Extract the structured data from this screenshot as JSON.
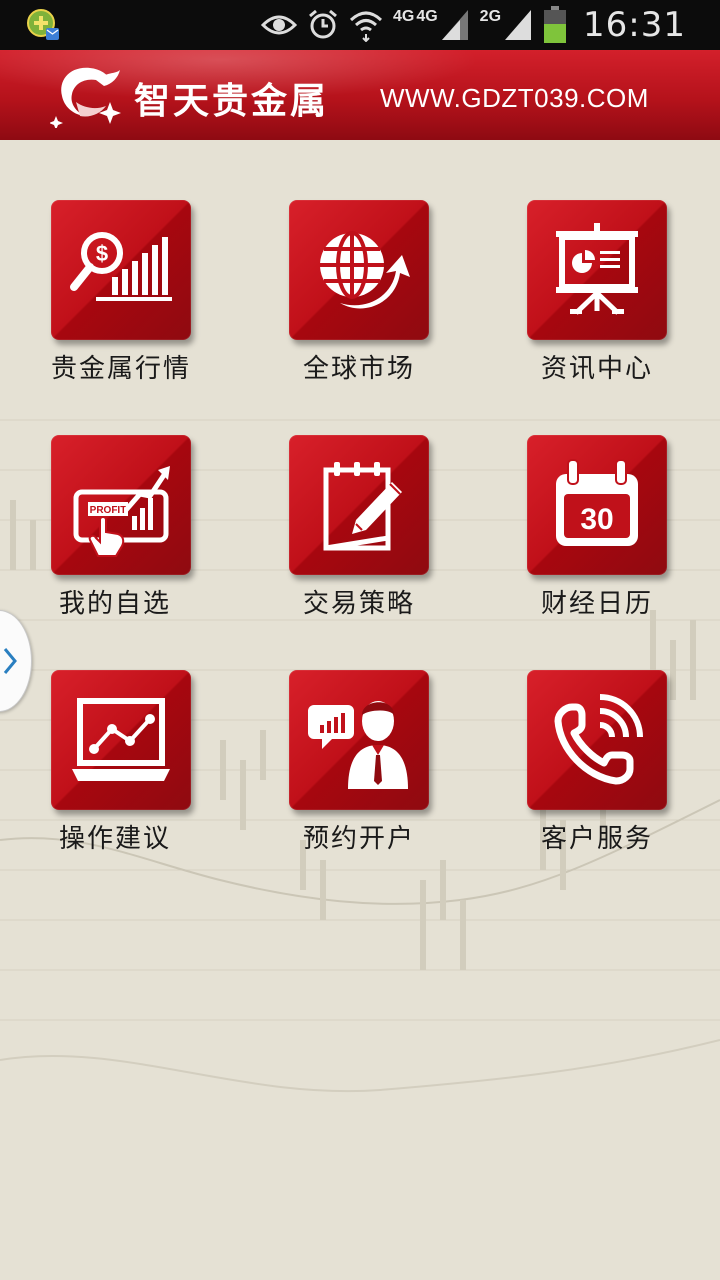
{
  "status_bar": {
    "time": "16:31",
    "network_labels": [
      "4G",
      "4G",
      "2G"
    ],
    "icons": [
      "app-notification-icon",
      "eye-icon",
      "alarm-icon",
      "wifi-icon",
      "signal-icon",
      "battery-icon"
    ]
  },
  "header": {
    "brand_name": "智天贵金属",
    "url": "WWW.GDZT039.COM"
  },
  "menu": {
    "items": [
      {
        "label": "贵金属行情",
        "icon": "price-chart-icon"
      },
      {
        "label": "全球市场",
        "icon": "globe-icon"
      },
      {
        "label": "资讯中心",
        "icon": "presentation-board-icon"
      },
      {
        "label": "我的自选",
        "icon": "profit-tablet-icon"
      },
      {
        "label": "交易策略",
        "icon": "notepad-pen-icon"
      },
      {
        "label": "财经日历",
        "icon": "calendar-icon"
      },
      {
        "label": "操作建议",
        "icon": "laptop-chart-icon"
      },
      {
        "label": "预约开户",
        "icon": "consultant-icon"
      },
      {
        "label": "客户服务",
        "icon": "phone-icon"
      }
    ],
    "icon_texts": {
      "dollar": "$",
      "profit": "PROFIT",
      "calendar_day": "30"
    }
  },
  "colors": {
    "accent": "#c0111a",
    "header_red": "#b5121b",
    "background": "#e5e1d4",
    "status_bar": "#0c0c0c"
  }
}
